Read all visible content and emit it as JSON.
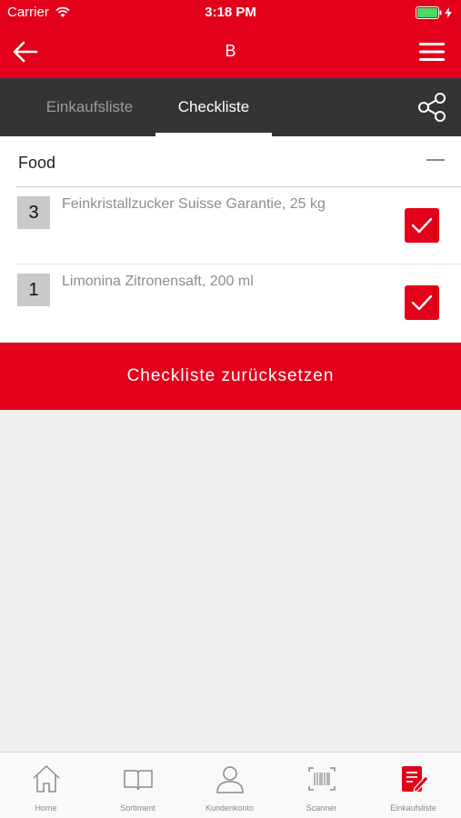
{
  "status_bar": {
    "carrier": "Carrier",
    "time": "3:18 PM"
  },
  "nav": {
    "title": "B",
    "back_icon": "arrow-left-icon",
    "menu_icon": "hamburger-icon"
  },
  "tabs": [
    {
      "label": "Einkaufsliste",
      "active": false
    },
    {
      "label": "Checkliste",
      "active": true
    }
  ],
  "share_icon": "share-icon",
  "section": {
    "label": "Food",
    "collapsed": false
  },
  "items": [
    {
      "qty": "3",
      "name": "Feinkristallzucker Suisse Garantie, 25 kg",
      "checked": true
    },
    {
      "qty": "1",
      "name": "Limonina Zitronensaft, 200 ml",
      "checked": true
    }
  ],
  "reset_button": "Checkliste zurücksetzen",
  "bottom_nav": [
    {
      "label": "Home",
      "icon": "home-icon"
    },
    {
      "label": "Sortiment",
      "icon": "book-icon"
    },
    {
      "label": "Kundenkonto",
      "icon": "person-icon"
    },
    {
      "label": "Scanner",
      "icon": "barcode-icon"
    },
    {
      "label": "Einkaufsliste",
      "icon": "list-edit-icon",
      "active": true
    }
  ],
  "colors": {
    "accent": "#e3001b",
    "tabbar": "#343434"
  }
}
